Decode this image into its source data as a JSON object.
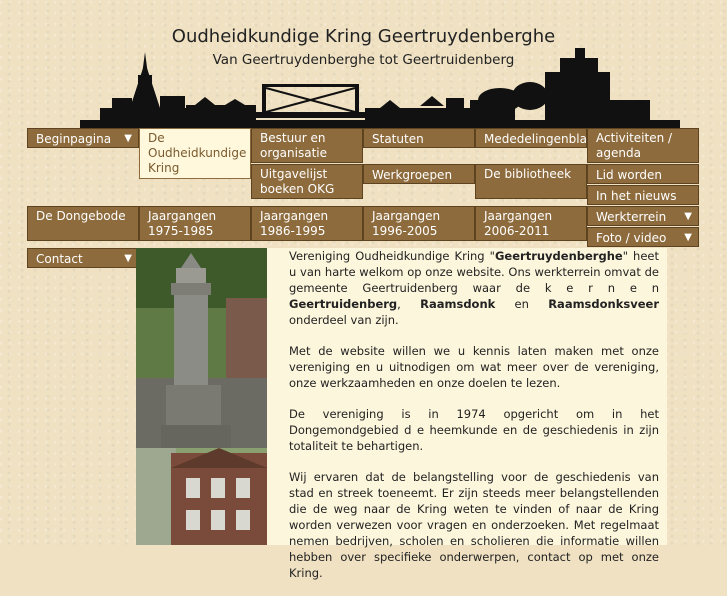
{
  "header": {
    "title": "Oudheidkundige Kring Geertruydenberghe",
    "subtitle": "Van Geertruydenberghe tot Geertruidenberg"
  },
  "nav": {
    "beginpagina": "Beginpagina",
    "de_oudheidkundige_kring": "De Oudheidkundige Kring",
    "bestuur": "Bestuur en organisatie",
    "statuten": "Statuten",
    "mededelingen": "Mededelingenblad",
    "activiteiten": "Activiteiten / agenda",
    "uitgevelijst": "Uitgavelijst boeken OKG",
    "werkgroepen": "Werkgroepen",
    "bibliotheek": "De bibliotheek",
    "lid_worden": "Lid worden",
    "in_het_nieuws": "In het nieuws",
    "werkterrein": "Werkterrein",
    "foto_video": "Foto / video",
    "dongebode": "De Dongebode",
    "jg_1975": "Jaargangen 1975-1985",
    "jg_1986": "Jaargangen 1986-1995",
    "jg_1996": "Jaargangen 1996-2005",
    "jg_2006": "Jaargangen 2006-2011",
    "contact": "Contact"
  },
  "icons": {
    "dropdown": "chevron-down-icon"
  },
  "intro": {
    "p1_a": "Vereniging Oudheidkundige Kring \"",
    "p1_name": "Geertruydenberghe",
    "p1_b": "\" heet u van harte welkom op onze website. Ons werkterrein omvat de gemeente Geertruidenberg waar de k e r n e n ",
    "p1_k1": "Geertruidenberg",
    "p1_c": ", ",
    "p1_k2": "Raamsdonk",
    "p1_d": " en ",
    "p1_k3": "Raamsdonksveer",
    "p1_e": " onderdeel van zijn.",
    "p2": "Met de website willen we u kennis laten maken met onze vereniging en u uitnodigen om wat meer over de vereniging, onze werkzaamheden en onze doelen te lezen.",
    "p3": "De vereniging is in 1974 opgericht om in het Dongemondgebied d e heemkunde en de geschiedenis in zijn totaliteit te behartigen.",
    "p4": "Wij ervaren dat de belangstelling voor de geschiedenis van stad en streek toeneemt. Er zijn steeds meer belangstellenden die de weg naar de Kring weten te vinden of naar de Kring worden verwezen voor vragen en onderzoeken. Met regelmaat nemen bedrijven, scholen en scholieren die informatie willen hebben over specifieke onderwerpen, contact op met onze Kring."
  },
  "colors": {
    "nav_bg": "#8e6b3c",
    "page_bg": "#efe1c2",
    "content_bg": "#fcf6dc"
  }
}
